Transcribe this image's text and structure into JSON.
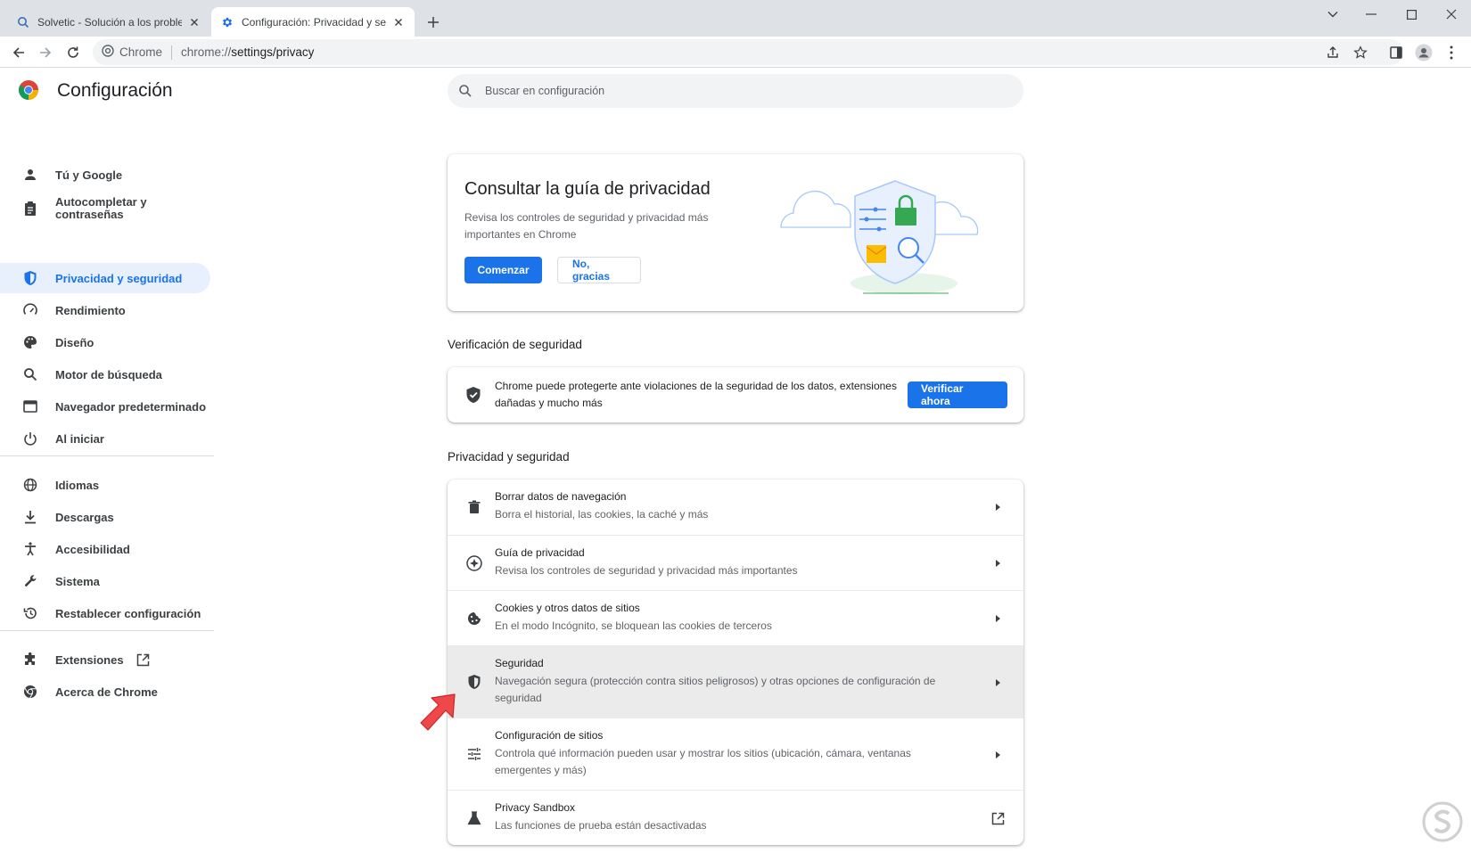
{
  "browser": {
    "tabs": [
      {
        "title": "Solvetic - Solución a los problemas",
        "active": false
      },
      {
        "title": "Configuración: Privacidad y seguridad",
        "active": true
      }
    ],
    "site_chip": "Chrome",
    "url_scheme": "chrome://",
    "url_path": "settings/privacy"
  },
  "settings": {
    "title": "Configuración",
    "search_placeholder": "Buscar en configuración",
    "sidebar": [
      {
        "label": "Tú y Google",
        "icon": "person-icon"
      },
      {
        "label": "Autocompletar y contraseñas",
        "icon": "clipboard-icon"
      },
      {
        "label": "Privacidad y seguridad",
        "icon": "shield-icon",
        "selected": true
      },
      {
        "label": "Rendimiento",
        "icon": "speedometer-icon"
      },
      {
        "label": "Diseño",
        "icon": "palette-icon"
      },
      {
        "label": "Motor de búsqueda",
        "icon": "search-icon"
      },
      {
        "label": "Navegador predeterminado",
        "icon": "browser-icon"
      },
      {
        "label": "Al iniciar",
        "icon": "power-icon"
      },
      {
        "label": "Idiomas",
        "icon": "globe-icon"
      },
      {
        "label": "Descargas",
        "icon": "download-icon"
      },
      {
        "label": "Accesibilidad",
        "icon": "accessibility-icon"
      },
      {
        "label": "Sistema",
        "icon": "wrench-icon"
      },
      {
        "label": "Restablecer configuración",
        "icon": "restore-icon"
      },
      {
        "label": "Extensiones",
        "icon": "puzzle-icon"
      },
      {
        "label": "Acerca de Chrome",
        "icon": "chrome-icon"
      }
    ],
    "privacy_guide_promo": {
      "title": "Consultar la guía de privacidad",
      "description": "Revisa los controles de seguridad y privacidad más importantes en Chrome",
      "start_label": "Comenzar",
      "dismiss_label": "No, gracias"
    },
    "safety_check": {
      "section_title": "Verificación de seguridad",
      "text": "Chrome puede protegerte ante violaciones de la seguridad de los datos, extensiones dañadas y mucho más",
      "button_label": "Verificar ahora"
    },
    "privacy_section": {
      "section_title": "Privacidad y seguridad",
      "rows": [
        {
          "title": "Borrar datos de navegación",
          "subtitle": "Borra el historial, las cookies, la caché y más",
          "icon": "trash-icon"
        },
        {
          "title": "Guía de privacidad",
          "subtitle": "Revisa los controles de seguridad y privacidad más importantes",
          "icon": "compass-icon"
        },
        {
          "title": "Cookies y otros datos de sitios",
          "subtitle": "En el modo Incógnito, se bloquean las cookies de terceros",
          "icon": "cookie-icon"
        },
        {
          "title": "Seguridad",
          "subtitle": "Navegación segura (protección contra sitios peligrosos) y otras opciones de configuración de seguridad",
          "icon": "security-shield-icon"
        },
        {
          "title": "Configuración de sitios",
          "subtitle": "Controla qué información pueden usar y mostrar los sitios (ubicación, cámara, ventanas emergentes y más)",
          "icon": "sliders-icon"
        },
        {
          "title": "Privacy Sandbox",
          "subtitle": "Las funciones de prueba están desactivadas",
          "icon": "flask-icon"
        }
      ]
    }
  },
  "colors": {
    "accent": "#1a73e8",
    "selected_bg": "#e8f0fe",
    "tabstrip_bg": "#dee1e6",
    "pointer_arrow": "#f0474a"
  }
}
